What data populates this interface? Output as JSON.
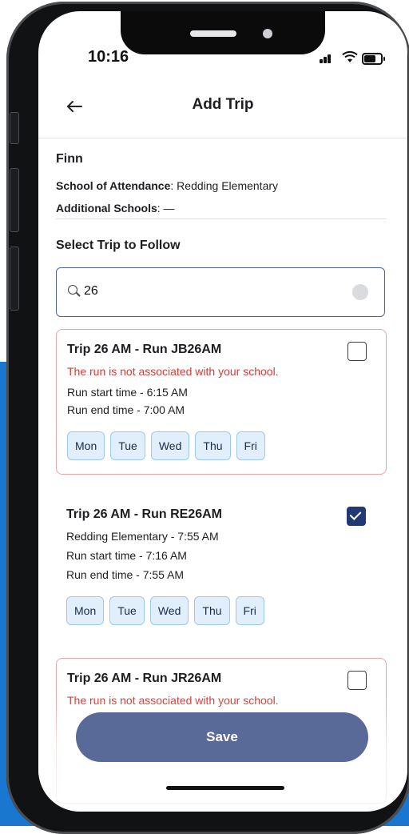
{
  "status_bar": {
    "time": "10:16"
  },
  "header": {
    "back_icon": "arrow-left-icon",
    "title": "Add Trip"
  },
  "student": {
    "name": "Finn",
    "school_label": "School of Attendance",
    "school_value": ": Redding Elementary",
    "additional_label": "Additional Schools",
    "additional_value": ": —"
  },
  "section_title": "Select Trip to Follow",
  "search": {
    "value": "26",
    "icon": "search-icon",
    "clear_icon": "clear-icon"
  },
  "trips": [
    {
      "title": "Trip 26 AM - Run JB26AM",
      "warning": "The run is not associated with your school.",
      "lines": [
        "Run start time - 6:15 AM",
        "Run end time - 7:00 AM"
      ],
      "days": [
        "Mon",
        "Tue",
        "Wed",
        "Thu",
        "Fri"
      ],
      "checked": false
    },
    {
      "title": "Trip 26 AM - Run RE26AM",
      "lines": [
        "Redding Elementary - 7:55 AM",
        "Run start time - 7:16 AM",
        "Run end time - 7:55 AM"
      ],
      "days": [
        "Mon",
        "Tue",
        "Wed",
        "Thu",
        "Fri"
      ],
      "checked": true
    },
    {
      "title": "Trip 26 AM - Run JR26AM",
      "warning": "The run is not associated with your school.",
      "checked": false
    }
  ],
  "save_label": "Save",
  "colors": {
    "accent": "#223a73",
    "save": "#5a6a98",
    "warning": "#d93a35",
    "day_chip": "#e1effc",
    "background_blue": "#1a77cf"
  }
}
